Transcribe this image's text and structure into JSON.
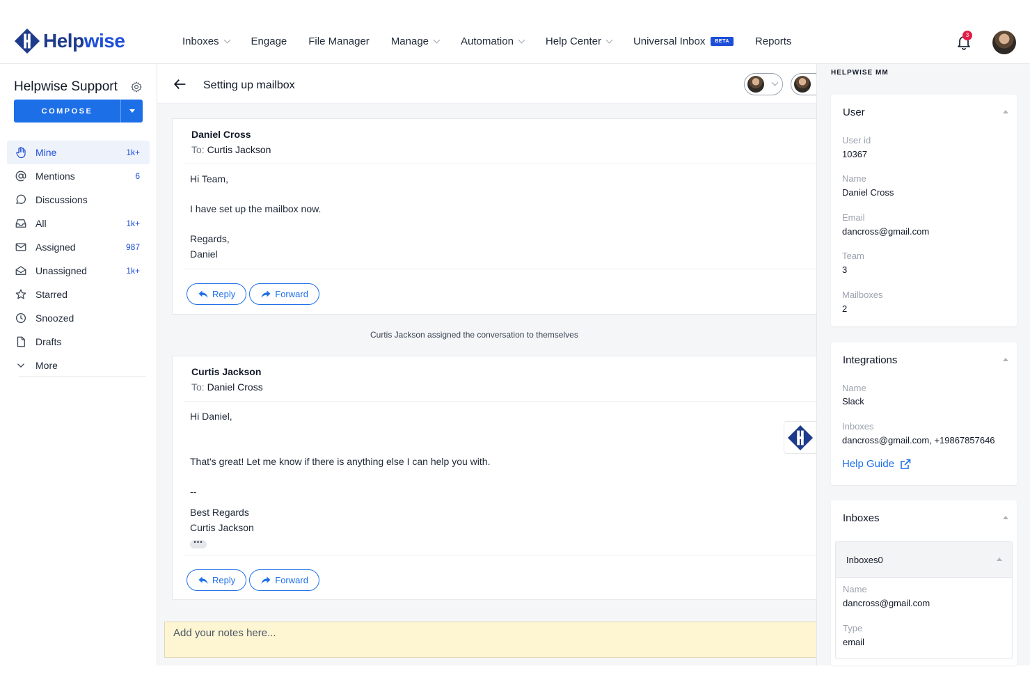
{
  "brand": {
    "name_part1": "Help",
    "name_part2": "wise"
  },
  "nav": {
    "items": [
      {
        "label": "Inboxes",
        "dropdown": true
      },
      {
        "label": "Engage",
        "dropdown": false
      },
      {
        "label": "File Manager",
        "dropdown": false
      },
      {
        "label": "Manage",
        "dropdown": true
      },
      {
        "label": "Automation",
        "dropdown": true
      },
      {
        "label": "Help Center",
        "dropdown": true
      },
      {
        "label": "Universal Inbox",
        "dropdown": false,
        "badge": "BETA"
      },
      {
        "label": "Reports",
        "dropdown": false
      }
    ],
    "notification_count": "3"
  },
  "sidebar": {
    "title": "Helpwise Support",
    "compose_label": "COMPOSE",
    "items": [
      {
        "label": "Mine",
        "count": "1k+",
        "icon": "hand-icon",
        "active": true
      },
      {
        "label": "Mentions",
        "count": "6",
        "icon": "at-icon"
      },
      {
        "label": "Discussions",
        "count": "",
        "icon": "chat-icon"
      },
      {
        "label": "All",
        "count": "1k+",
        "icon": "inbox-icon"
      },
      {
        "label": "Assigned",
        "count": "987",
        "icon": "mail-icon"
      },
      {
        "label": "Unassigned",
        "count": "1k+",
        "icon": "mail-open-icon"
      },
      {
        "label": "Starred",
        "count": "",
        "icon": "star-icon"
      },
      {
        "label": "Snoozed",
        "count": "",
        "icon": "clock-icon"
      },
      {
        "label": "Drafts",
        "count": "",
        "icon": "file-icon"
      },
      {
        "label": "More",
        "count": "",
        "icon": "chevron-down-icon"
      }
    ]
  },
  "conversation": {
    "title": "Setting up mailbox",
    "messages": [
      {
        "sender": "Daniel Cross",
        "to_label": "To:",
        "to": "Curtis Jackson",
        "lines": [
          "Hi Team,",
          "I have set up the mailbox now.",
          "Regards,",
          "Daniel"
        ],
        "reply_label": "Reply",
        "forward_label": "Forward"
      },
      {
        "sender": "Curtis Jackson",
        "to_label": "To:",
        "to": "Daniel Cross",
        "lines": [
          "Hi Daniel,",
          "That's great! Let me know if there is anything else I can help you with.",
          "--",
          "Best Regards",
          "Curtis Jackson"
        ],
        "ellipsis": "•••",
        "reply_label": "Reply",
        "forward_label": "Forward"
      }
    ],
    "system_note": "Curtis Jackson assigned the conversation to themselves",
    "notes_placeholder": "Add your notes here..."
  },
  "right_panel": {
    "header": "HELPWISE MM",
    "user": {
      "title": "User",
      "fields": [
        {
          "label": "User id",
          "value": "10367"
        },
        {
          "label": "Name",
          "value": "Daniel Cross"
        },
        {
          "label": "Email",
          "value": "dancross@gmail.com"
        },
        {
          "label": "Team",
          "value": "3"
        },
        {
          "label": "Mailboxes",
          "value": "2"
        }
      ]
    },
    "integrations": {
      "title": "Integrations",
      "fields": [
        {
          "label": "Name",
          "value": "Slack"
        },
        {
          "label": "Inboxes",
          "value": "dancross@gmail.com, +19867857646"
        }
      ],
      "help_guide": "Help Guide"
    },
    "inboxes": {
      "title": "Inboxes",
      "sub_title": "Inboxes0",
      "fields": [
        {
          "label": "Name",
          "value": "dancross@gmail.com"
        },
        {
          "label": "Type",
          "value": "email"
        }
      ]
    }
  },
  "colors": {
    "accent": "#1d6fe8",
    "brand_dark": "#1e3a8a",
    "notes_bg": "#fef5d3",
    "badge_red": "#e11d48"
  }
}
